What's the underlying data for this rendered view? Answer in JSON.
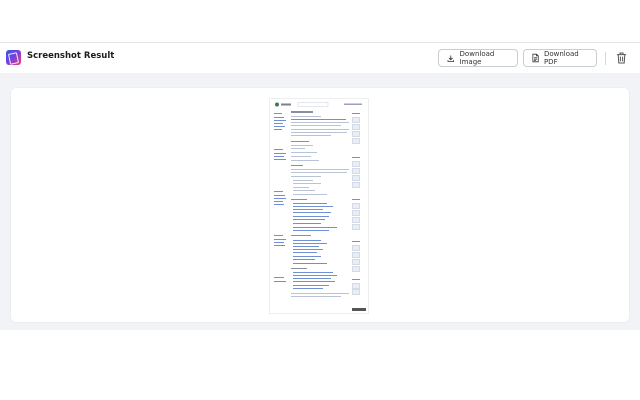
{
  "header": {
    "title": "Screenshot Result",
    "download_image_label": "Download Image",
    "download_pdf_label": "Download PDF"
  },
  "icons": {
    "logo": "app-logo-icon",
    "download": "download-icon",
    "pdf": "document-icon",
    "delete": "trash-icon"
  },
  "colors": {
    "stage_bg": "#f2f3f6",
    "card_bg": "#ffffff",
    "logo_gradient": [
      "#2f58e6",
      "#7b3fe0",
      "#ef3f6c"
    ]
  }
}
